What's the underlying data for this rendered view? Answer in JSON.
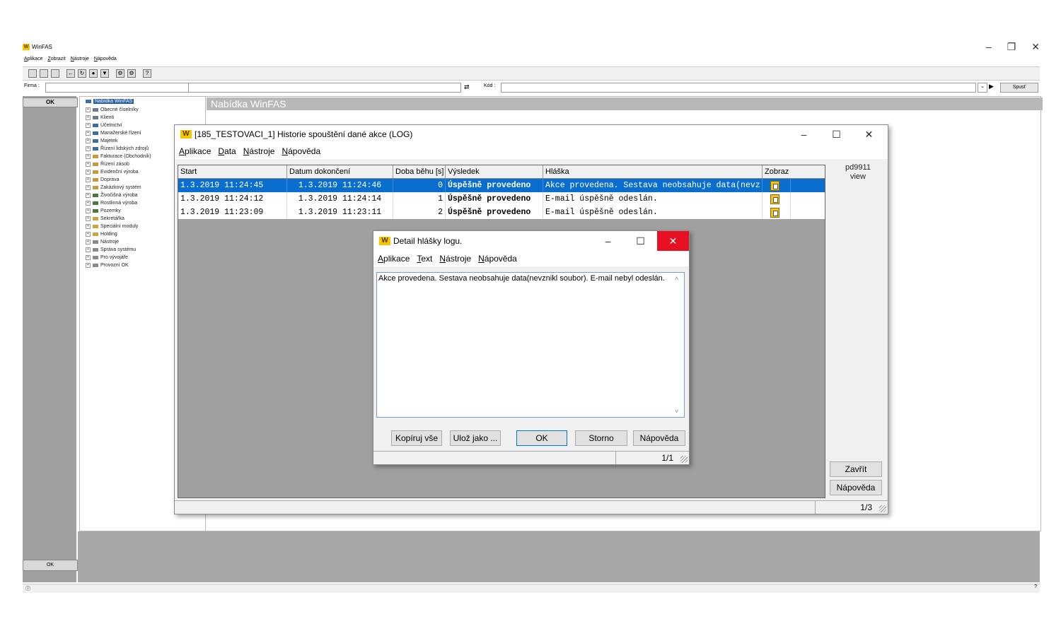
{
  "main": {
    "title": "WinFAS",
    "menu": [
      "Aplikace",
      "Zobrazit",
      "Nástroje",
      "Nápověda"
    ],
    "controls": {
      "minimize": "–",
      "restore": "❐",
      "close": "✕"
    },
    "firma_label": "Firma :",
    "kod_label": "Kód :",
    "spust_label": "Spusť",
    "ok_top": "OK",
    "ok_bottom": "OK",
    "nabidka_header": "Nabídka WinFAS"
  },
  "tree": {
    "items": [
      "Nabídka WinFAS",
      "Obecné číselníky",
      "Klienti",
      "Účetnictví",
      "Manažerské řízení",
      "Majetek",
      "Řízení lidských zdrojů",
      "Fakturace (Obchodník)",
      "Řízení zásob",
      "Evidenční výroba",
      "Doprava",
      "Zakázkový systém",
      "Živočišná výroba",
      "Rostlinná výroba",
      "Pozemky",
      "Sekretářka",
      "Speciální moduly",
      "Holding",
      "Nástroje",
      "Správa systému",
      "Pro vývojáře",
      "Provozní OK"
    ]
  },
  "log_window": {
    "title": "[185_TESTOVACI_1] Historie spouštění dané akce (LOG)",
    "menu": [
      "Aplikace",
      "Data",
      "Nástroje",
      "Nápověda"
    ],
    "columns": [
      "Start",
      "Datum dokončení",
      "Doba běhu [s]",
      "Výsledek",
      "Hláška",
      "Zobraz"
    ],
    "rows": [
      {
        "start": "1.3.2019 11:24:45",
        "end": "1.3.2019 11:24:46",
        "duration": "0",
        "result": "Úspěšně provedeno",
        "message": "Akce provedena. Sestava neobsahuje data(nevz"
      },
      {
        "start": "1.3.2019 11:24:12",
        "end": "1.3.2019 11:24:14",
        "duration": "1",
        "result": "Úspěšně provedeno",
        "message": "E-mail úspěšně odeslán."
      },
      {
        "start": "1.3.2019 11:23:09",
        "end": "1.3.2019 11:23:11",
        "duration": "2",
        "result": "Úspěšně provedeno",
        "message": "E-mail úspěšně odeslán."
      }
    ],
    "side_label_1": "pd9911",
    "side_label_2": "view",
    "close_button": "Zavřít",
    "help_button": "Nápověda",
    "page": "1/3",
    "selection_color": "#0a6ecf"
  },
  "detail_window": {
    "title": "Detail hlášky logu.",
    "menu": [
      "Aplikace",
      "Text",
      "Nástroje",
      "Nápověda"
    ],
    "text": "Akce provedena. Sestava neobsahuje data(nevznikl soubor). E-mail nebyl odeslán.",
    "buttons": {
      "copy": "Kopíruj vše",
      "save": "Ulož jako ...",
      "ok": "OK",
      "cancel": "Storno",
      "help": "Nápověda"
    },
    "page": "1/1",
    "close_color": "#e81123"
  }
}
